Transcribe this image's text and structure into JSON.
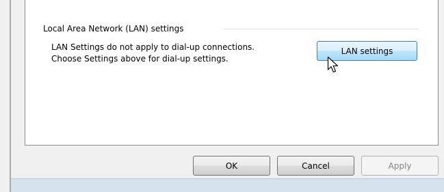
{
  "lan_group": {
    "title": "Local Area Network (LAN) settings",
    "description_line1": "LAN Settings do not apply to dial-up connections.",
    "description_line2": "Choose Settings above for dial-up settings.",
    "lan_settings_button": "LAN settings"
  },
  "footer": {
    "ok_label": "OK",
    "cancel_label": "Cancel",
    "apply_label": "Apply"
  },
  "cursor": {
    "icon": "arrow-pointer-icon"
  }
}
